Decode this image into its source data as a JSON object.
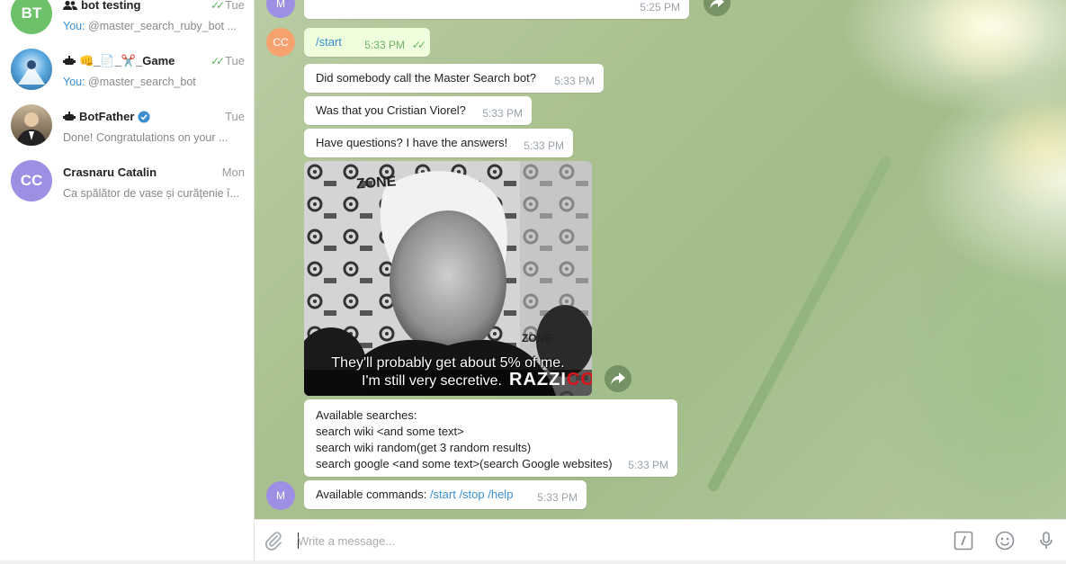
{
  "sidebar": {
    "chats": [
      {
        "initials": "BT",
        "avatar_color": "#6cc16a",
        "name": "bot testing",
        "time": "Tue",
        "preview_prefix": "You:",
        "preview": " @master_search_ruby_bot ...",
        "group": true,
        "read": true
      },
      {
        "initials": "",
        "avatar_color": "#5ba9e0",
        "name": "👊_📄_✂️_Game",
        "time": "Tue",
        "preview_prefix": "You:",
        "preview": " @master_search_bot",
        "group": false,
        "read": true
      },
      {
        "initials": "",
        "avatar_color": "#7d6a58",
        "name": "BotFather",
        "time": "Tue",
        "preview_prefix": "",
        "preview": "Done! Congratulations on your ...",
        "verified": true
      },
      {
        "initials": "CC",
        "avatar_color": "#9d8fe3",
        "name": "Crasnaru Catalin",
        "time": "Mon",
        "preview_prefix": "",
        "preview": "Ca spălător de vase și curățenie î..."
      }
    ]
  },
  "chat": {
    "top_avatar": "M",
    "top_time": "5:25 PM",
    "user_avatar": "CC",
    "bot_avatar": "M",
    "messages": [
      {
        "text": "/start",
        "time": "5:33 PM",
        "outgoing": true
      },
      {
        "text": "Did somebody call the Master Search bot?",
        "time": "5:33 PM"
      },
      {
        "text": "Was that you Cristian Viorel?",
        "time": "5:33 PM"
      },
      {
        "text": "Have questions? I have the answers!",
        "time": "5:33 PM"
      }
    ],
    "gif": {
      "caption_line1": "They'll probably get about 5% of me.",
      "caption_line2": "I'm still very secretive.",
      "brand_prefix": "RAZZI",
      "brand_suffix": "CO",
      "sign_text": "ZONE"
    },
    "available_searches": {
      "lines": [
        "Available searches:",
        "search wiki <and some text>",
        "search wiki random(get 3 random results)",
        "search google <and some text>(search Google websites)"
      ],
      "time": "5:33 PM"
    },
    "commands": {
      "label": "Available commands: ",
      "links": "/start /stop /help",
      "time": "5:33 PM"
    }
  },
  "composer": {
    "placeholder": "Write a message..."
  },
  "colors": {
    "accent": "#3a8fd0",
    "read_check": "#5ab55a"
  }
}
